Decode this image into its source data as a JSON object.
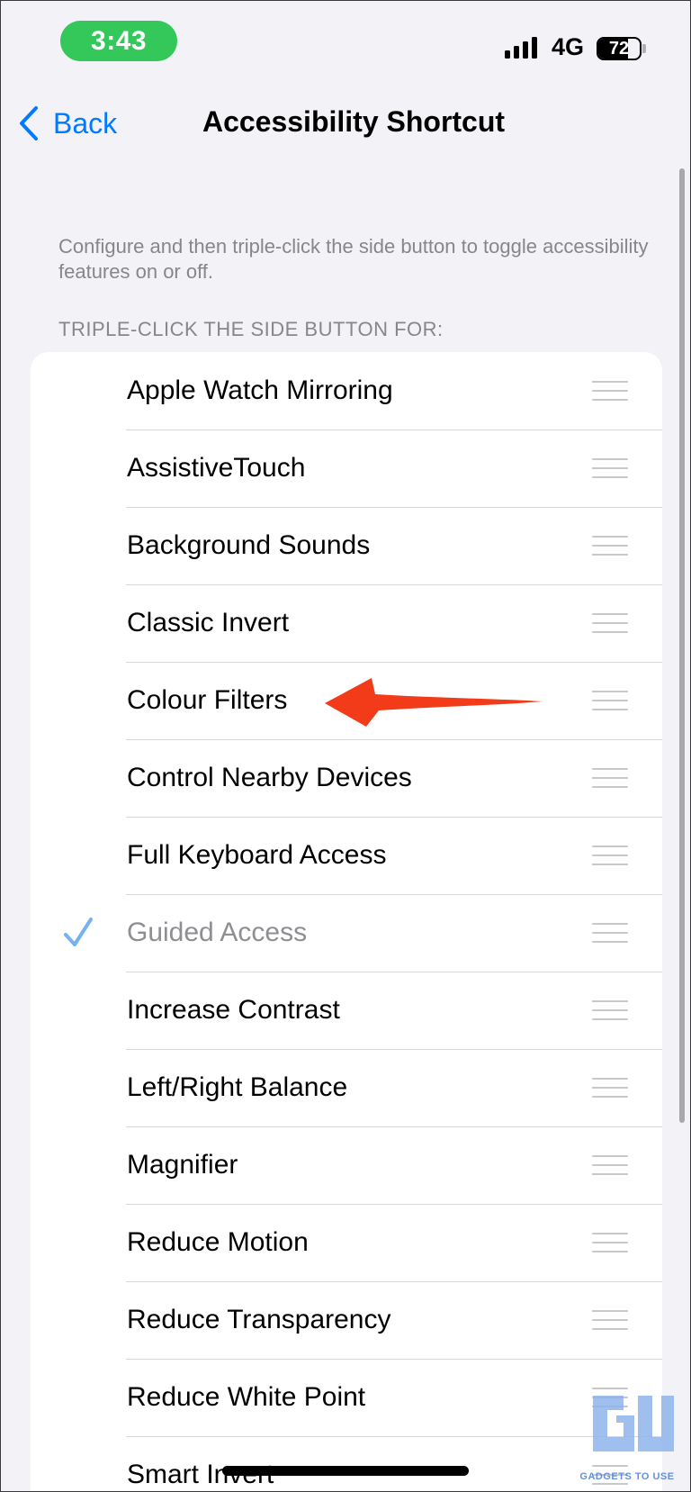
{
  "status_bar": {
    "time": "3:43",
    "network": "4G",
    "battery_level": "72",
    "battery_fraction": 0.72,
    "signal_bars": 4,
    "colors": {
      "time_pill": "#34c759"
    }
  },
  "nav": {
    "back_label": "Back",
    "title": "Accessibility Shortcut",
    "back_icon": "chevron-left-icon"
  },
  "description": "Configure and then triple-click the side button to toggle accessibility features on or off.",
  "section_header": "TRIPLE-CLICK THE SIDE BUTTON FOR:",
  "items": [
    {
      "label": "Apple Watch Mirroring",
      "checked": false
    },
    {
      "label": "AssistiveTouch",
      "checked": false
    },
    {
      "label": "Background Sounds",
      "checked": false
    },
    {
      "label": "Classic Invert",
      "checked": false
    },
    {
      "label": "Colour Filters",
      "checked": false
    },
    {
      "label": "Control Nearby Devices",
      "checked": false
    },
    {
      "label": "Full Keyboard Access",
      "checked": false
    },
    {
      "label": "Guided Access",
      "checked": true
    },
    {
      "label": "Increase Contrast",
      "checked": false
    },
    {
      "label": "Left/Right Balance",
      "checked": false
    },
    {
      "label": "Magnifier",
      "checked": false
    },
    {
      "label": "Reduce Motion",
      "checked": false
    },
    {
      "label": "Reduce Transparency",
      "checked": false
    },
    {
      "label": "Reduce White Point",
      "checked": false
    },
    {
      "label": "Smart Invert",
      "checked": false
    }
  ],
  "annotation": {
    "icon": "red-arrow-icon",
    "color": "#f23b18"
  },
  "watermark": {
    "logo": "gadgets-to-use-logo",
    "text": "GADGETS TO USE"
  },
  "colors": {
    "accent": "#007aff",
    "background": "#f2f2f7",
    "check": "#74b3f0",
    "secondary_text": "#86868b"
  }
}
